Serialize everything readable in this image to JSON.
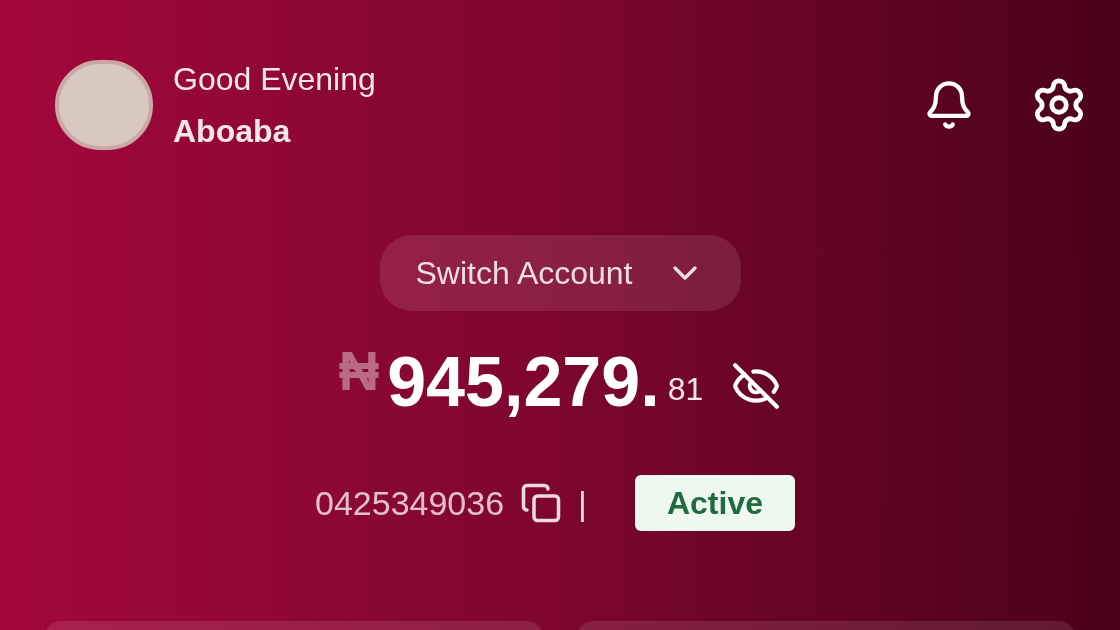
{
  "header": {
    "greeting": "Good Evening",
    "name": "Aboaba"
  },
  "account_switcher": {
    "label": "Switch Account"
  },
  "balance": {
    "currency": "₦",
    "whole": "945,279.",
    "fraction": "81"
  },
  "account": {
    "number": "0425349036",
    "separator": "|",
    "status": "Active"
  }
}
